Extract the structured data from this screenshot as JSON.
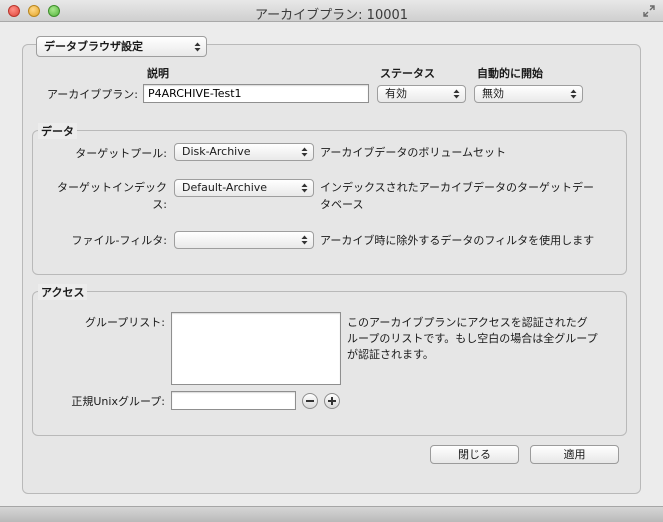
{
  "window": {
    "title": "アーカイブプラン: 10001"
  },
  "view_selector": {
    "value": "データブラウザ設定"
  },
  "header": {
    "description_heading": "説明",
    "status_heading": "ステータス",
    "autostart_heading": "自動的に開始"
  },
  "plan": {
    "label": "アーカイブプラン:",
    "description_value": "P4ARCHIVE-Test1",
    "status_value": "有効",
    "autostart_value": "無効"
  },
  "data_section": {
    "title": "データ",
    "target_pool_label": "ターゲットプール:",
    "target_pool_value": "Disk-Archive",
    "target_pool_note": "アーカイブデータのボリュームセット",
    "target_index_label_1": "ターゲットインデック",
    "target_index_label_2": "ス:",
    "target_index_value": "Default-Archive",
    "target_index_note_1": "インデックスされたアーカイブデータのターゲットデー",
    "target_index_note_2": "タベース",
    "file_filter_label": "ファイル-フィルタ:",
    "file_filter_value": "",
    "file_filter_note": "アーカイブ時に除外するデータのフィルタを使用します"
  },
  "access_section": {
    "title": "アクセス",
    "group_list_label": "グループリスト:",
    "group_list_items": [],
    "group_note_1": "このアーカイブプランにアクセスを認証されたグ",
    "group_note_2": "ループのリストです。もし空白の場合は全グループ",
    "group_note_3": "が認証されます。",
    "unix_group_label": "正規Unixグループ:",
    "unix_group_value": ""
  },
  "buttons": {
    "close": "閉じる",
    "apply": "適用"
  }
}
